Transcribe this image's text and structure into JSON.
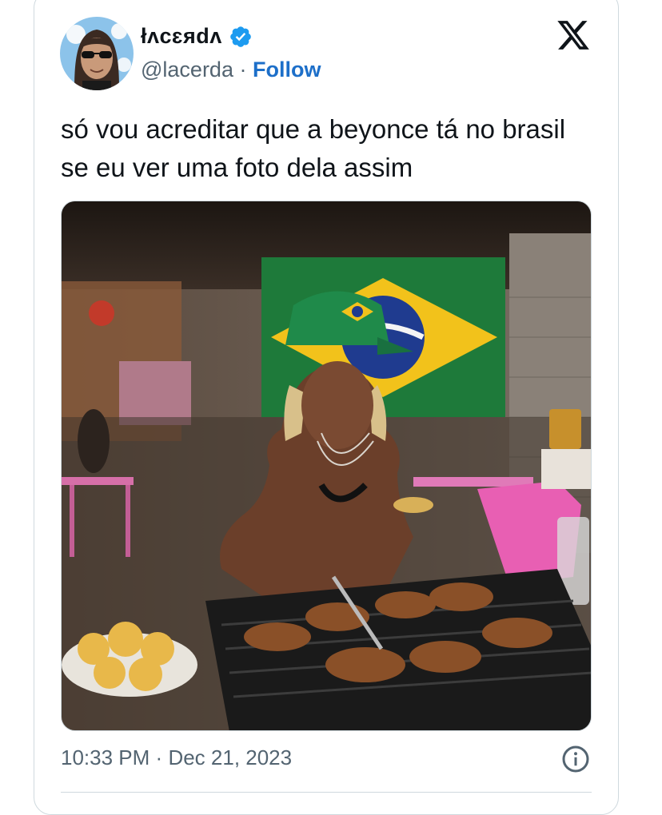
{
  "author": {
    "display_name": "łᴧcɛяdᴧ",
    "handle": "@lacerda",
    "separator": "·",
    "follow_label": "Follow",
    "verified": true
  },
  "tweet": {
    "text": "só vou acreditar que a beyonce tá no brasil se eu ver uma foto dela assim",
    "time": "10:33 PM",
    "date": "Dec 21, 2023",
    "meta_separator": "·"
  },
  "icons": {
    "verified": "verified-badge-icon",
    "brand": "x-logo-icon",
    "info": "info-icon"
  },
  "colors": {
    "follow": "#1d6fc9",
    "verified": "#1d9bf0",
    "secondary_text": "#536471"
  }
}
